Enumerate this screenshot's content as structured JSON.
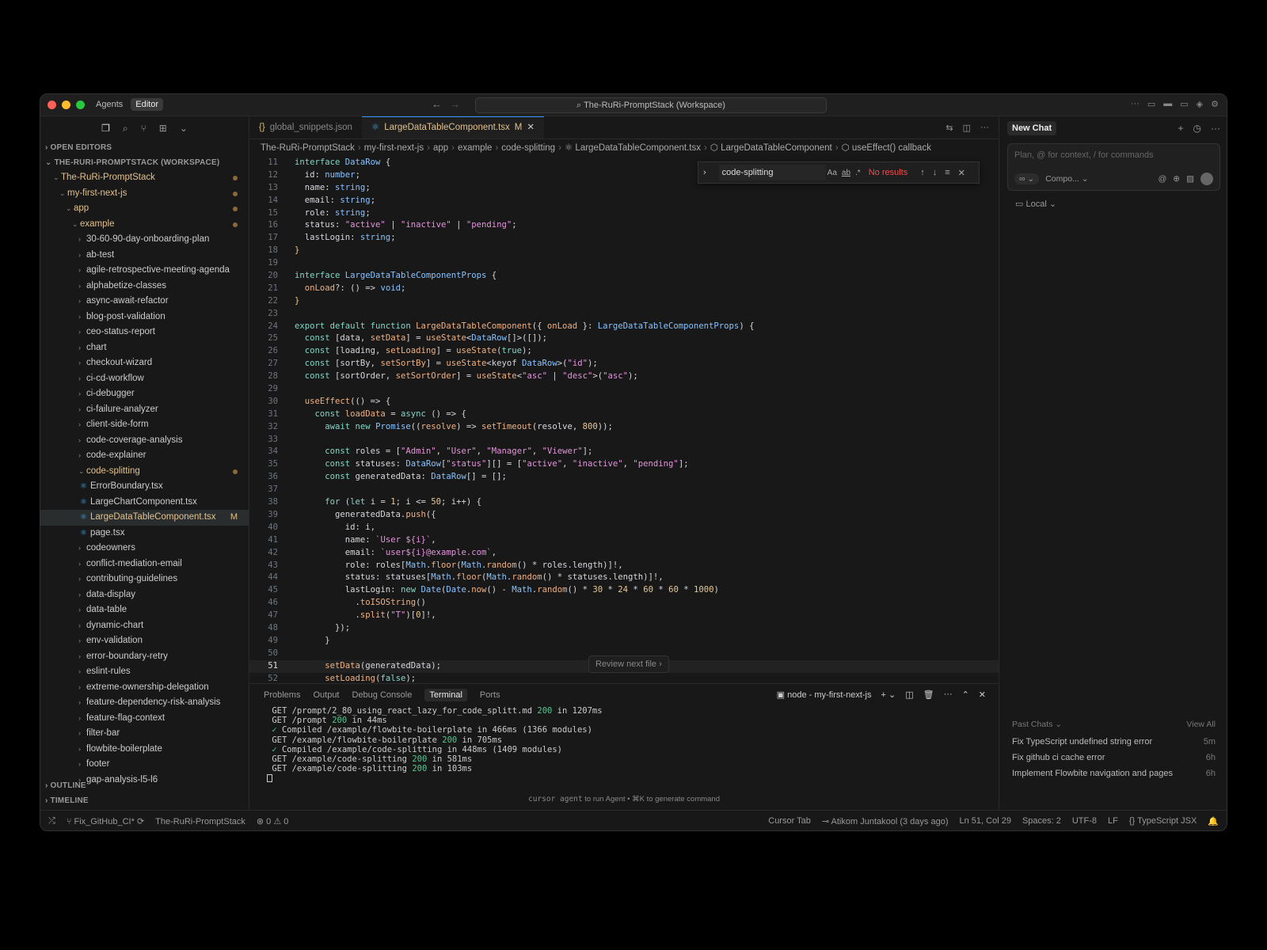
{
  "titlebar": {
    "modes": [
      "Agents",
      "Editor"
    ],
    "active_mode": "Editor",
    "search": "The-RuRi-PromptStack (Workspace)"
  },
  "sidebar": {
    "open_editors": "OPEN EDITORS",
    "workspace": "THE-RURI-PROMPTSTACK (WORKSPACE)",
    "root": "The-RuRi-PromptStack",
    "project": "my-first-next-js",
    "app": "app",
    "example": "example",
    "folders_before": [
      "30-60-90-day-onboarding-plan",
      "ab-test",
      "agile-retrospective-meeting-agenda",
      "alphabetize-classes",
      "async-await-refactor",
      "blog-post-validation",
      "ceo-status-report",
      "chart",
      "checkout-wizard",
      "ci-cd-workflow",
      "ci-debugger",
      "ci-failure-analyzer",
      "client-side-form",
      "code-coverage-analysis",
      "code-explainer"
    ],
    "open_folder": "code-splitting",
    "files": [
      "ErrorBoundary.tsx",
      "LargeChartComponent.tsx",
      "LargeDataTableComponent.tsx",
      "page.tsx"
    ],
    "selected_file_badge": "M",
    "folders_after": [
      "codeowners",
      "conflict-mediation-email",
      "contributing-guidelines",
      "data-display",
      "data-table",
      "dynamic-chart",
      "env-validation",
      "error-boundary-retry",
      "eslint-rules",
      "extreme-ownership-delegation",
      "feature-dependency-risk-analysis",
      "feature-flag-context",
      "filter-bar",
      "flowbite-boilerplate",
      "footer",
      "gap-analysis-l5-l6"
    ],
    "outline": "OUTLINE",
    "timeline": "TIMELINE"
  },
  "editor": {
    "tabs": [
      {
        "label": "global_snippets.json",
        "icon": "json-icon"
      },
      {
        "label": "LargeDataTableComponent.tsx",
        "badge": "M",
        "icon": "react-icon"
      }
    ],
    "breadcrumb": [
      "The-RuRi-PromptStack",
      "my-first-next-js",
      "app",
      "example",
      "code-splitting",
      "LargeDataTableComponent.tsx",
      "LargeDataTableComponent",
      "useEffect() callback"
    ],
    "find": {
      "query": "code-splitting",
      "result": "No results"
    },
    "review_next": "Review next file",
    "current_line": 51
  },
  "panel": {
    "tabs": [
      "Problems",
      "Output",
      "Debug Console",
      "Terminal",
      "Ports"
    ],
    "active_tab": "Terminal",
    "terminal_name": "node - my-first-next-js",
    "lines": [
      {
        "pre": " GET /prompt/2_80_using_react_lazy_for_code_splitt.md ",
        "ok": "200",
        "post": " in 1207ms"
      },
      {
        "pre": " GET /prompt ",
        "ok": "200",
        "post": " in 44ms"
      },
      {
        "pre": "",
        "ok": " ✓",
        "post": " Compiled /example/flowbite-boilerplate in 466ms (1366 modules)"
      },
      {
        "pre": " GET /example/flowbite-boilerplate ",
        "ok": "200",
        "post": " in 705ms"
      },
      {
        "pre": "",
        "ok": " ✓",
        "post": " Compiled /example/code-splitting in 448ms (1409 modules)"
      },
      {
        "pre": " GET /example/code-splitting ",
        "ok": "200",
        "post": " in 581ms"
      },
      {
        "pre": " GET /example/code-splitting ",
        "ok": "200",
        "post": " in 103ms"
      }
    ],
    "hint_cmd": "cursor agent",
    "hint_rest": " to run Agent • ⌘K to generate command"
  },
  "chat": {
    "tab": "New Chat",
    "placeholder": "Plan, @ for context, / for commands",
    "mode": "∞",
    "model": "Compo...",
    "local": "Local",
    "past_label": "Past Chats",
    "view_all": "View All",
    "past": [
      {
        "title": "Fix TypeScript undefined string error",
        "time": "5m"
      },
      {
        "title": "Fix github ci cache error",
        "time": "6h"
      },
      {
        "title": "Implement Flowbite navigation and pages",
        "time": "6h"
      }
    ]
  },
  "status": {
    "branch": "Fix_GitHub_CI*",
    "workspace": "The-RuRi-PromptStack",
    "problems": "⊗ 0 ⚠ 0",
    "cursor_tab": "Cursor Tab",
    "blame": "Atikom Juntakool (3 days ago)",
    "position": "Ln 51, Col 29",
    "spaces": "Spaces: 2",
    "encoding": "UTF-8",
    "eol": "LF",
    "language": "TypeScript JSX"
  }
}
